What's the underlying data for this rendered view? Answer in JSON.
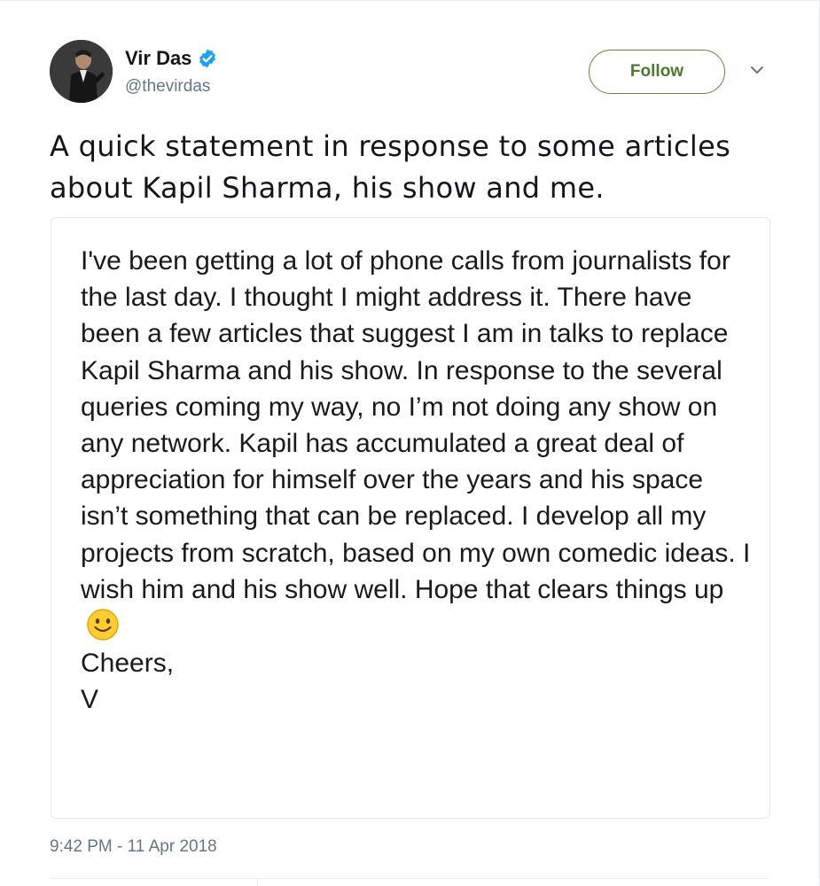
{
  "author": {
    "name": "Vir Das",
    "handle": "@thevirdas",
    "verified_icon": "verified-badge-icon",
    "avatar_icon": "profile-photo"
  },
  "actions": {
    "follow_label": "Follow",
    "menu_icon": "chevron-down-icon"
  },
  "tweet": {
    "text": "A quick statement in response to some articles about Kapil Sharma, his show and me.",
    "statement_body": "I've been getting a lot of phone calls from journalists for the last day. I thought I might address it. There have been a few articles that suggest I am in talks to replace Kapil Sharma and his show. In response to the several queries coming my way, no I’m not doing any show on any network. Kapil has accumulated a great deal of appreciation for himself over the years and his space isn’t something that can be replaced. I develop all my projects from scratch, based on my own comedic ideas. I wish him and his show well. Hope that clears things up",
    "statement_emoji": "smiley-emoji-icon",
    "statement_signoff": "Cheers,",
    "statement_signature": "V",
    "timestamp": "9:42 PM - 11 Apr 2018"
  },
  "colors": {
    "follow_border": "#5b8c35",
    "verified_blue": "#1da1f2",
    "muted_text": "#657786"
  }
}
